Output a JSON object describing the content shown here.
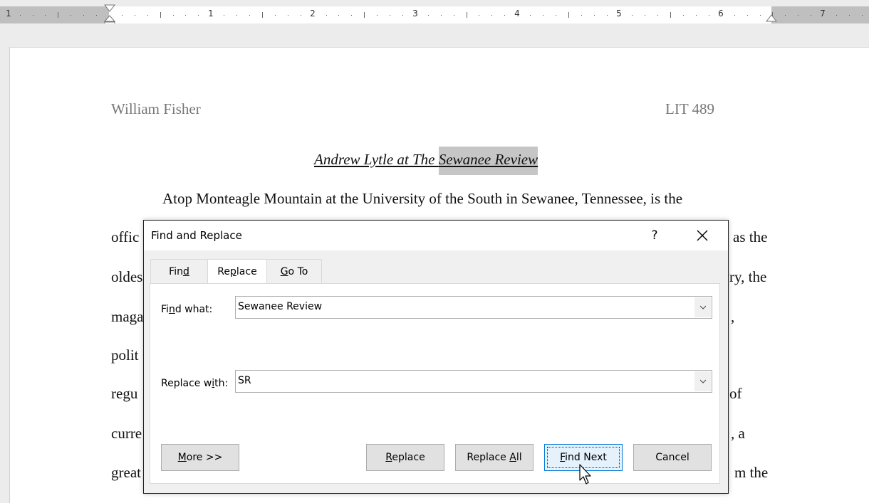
{
  "ruler": {
    "numbers": [
      "1",
      "1",
      "2",
      "3",
      "4",
      "5",
      "6",
      "7"
    ]
  },
  "document": {
    "header_left": "William Fisher",
    "header_right": "LIT 489",
    "title_prefix": "Andrew Lytle at The ",
    "title_highlight": "Sewanee Review",
    "line1": "Atop Monteagle Mountain at the University of the South in Sewanee, Tennessee, is the",
    "line2_left": "offic",
    "line2_right": "as the",
    "line3_left": "oldes",
    "line3_right": "ry, the",
    "line4_left": "maga",
    "line4_right": ",",
    "line5_left": "polit",
    "line6_left": "regu",
    "line6_right": "of",
    "line7_left": "curre",
    "line7_right": ", a",
    "line8_left": "great",
    "line8_right": "m the"
  },
  "dialog": {
    "title": "Find and Replace",
    "help": "?",
    "tabs": [
      {
        "label_pre": "Fin",
        "label_ul": "d",
        "label_post": ""
      },
      {
        "label_pre": "Re",
        "label_ul": "p",
        "label_post": "lace"
      },
      {
        "label_pre": "",
        "label_ul": "G",
        "label_post": "o To"
      }
    ],
    "active_tab": "Replace",
    "find_label_pre": "Fi",
    "find_label_ul": "n",
    "find_label_post": "d what:",
    "find_value": "Sewanee Review",
    "replace_label_pre": "Replace w",
    "replace_label_ul": "i",
    "replace_label_post": "th:",
    "replace_value": "SR",
    "buttons": {
      "more_ul": "M",
      "more_rest": "ore >>",
      "replace_ul": "R",
      "replace_rest": "eplace",
      "replace_all_pre": "Replace ",
      "replace_all_ul": "A",
      "replace_all_post": "ll",
      "find_next_ul": "F",
      "find_next_rest": "ind Next",
      "cancel": "Cancel"
    }
  },
  "colors": {
    "highlight": "#c6c6c6",
    "default_button_border": "#0078d7"
  }
}
